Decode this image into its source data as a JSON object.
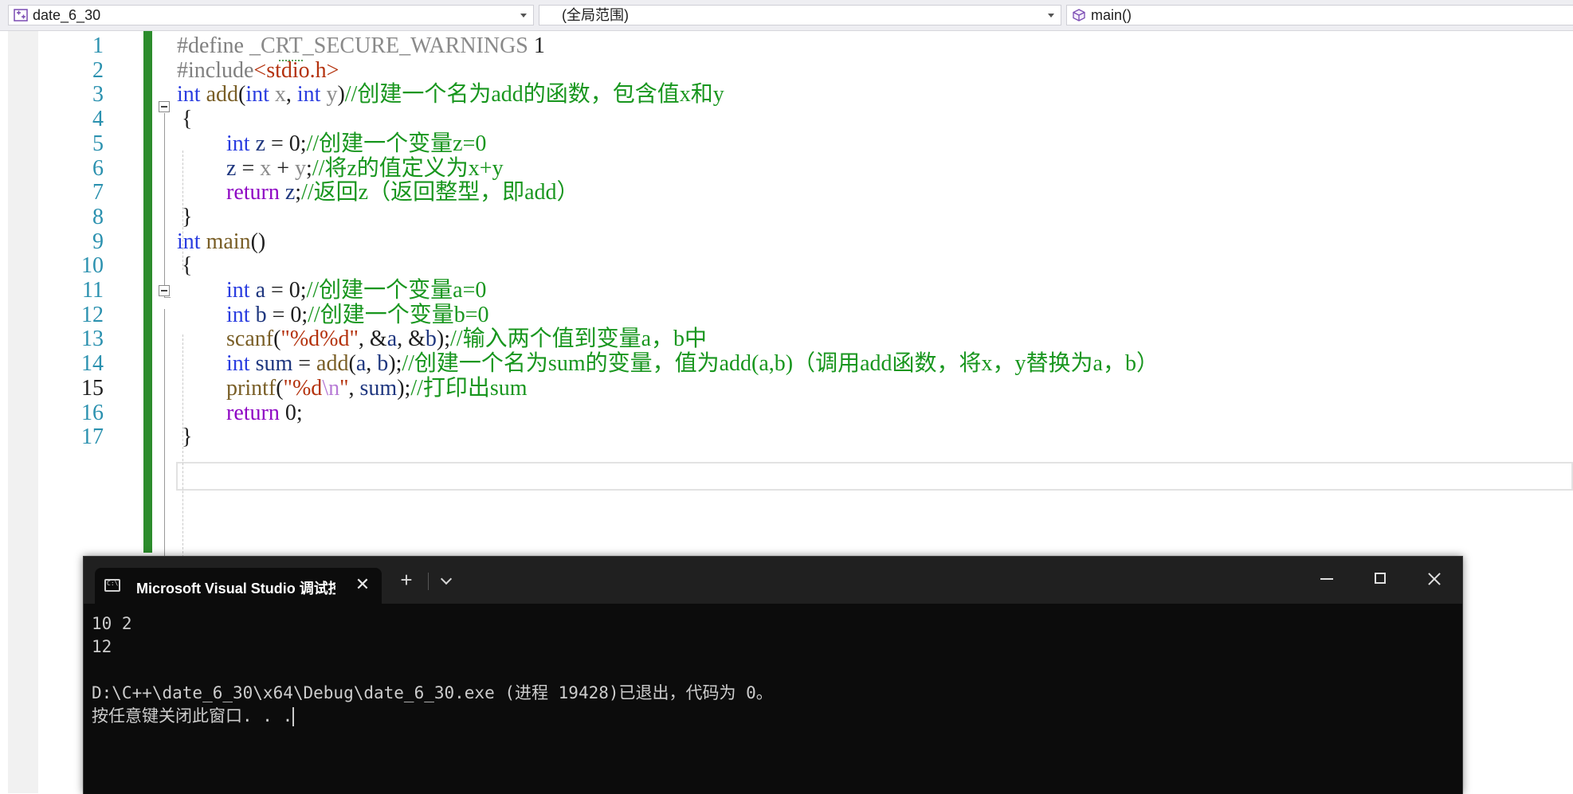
{
  "navbar": {
    "project": "date_6_30",
    "scope": "(全局范围)",
    "member": "main()"
  },
  "editor": {
    "line_numbers": [
      "1",
      "2",
      "3",
      "4",
      "5",
      "6",
      "7",
      "8",
      "9",
      "10",
      "11",
      "12",
      "13",
      "14",
      "15",
      "16",
      "17"
    ],
    "current_line": 15,
    "lines": [
      [
        [
          "#define ",
          "pp"
        ],
        [
          "_CRT_SECURE_WARNINGS",
          "pr"
        ],
        [
          " 1",
          "tx"
        ]
      ],
      [
        [
          "#include",
          "pp"
        ],
        [
          "<stdio.h>",
          "st"
        ]
      ],
      [
        [
          "int",
          "kw"
        ],
        [
          " ",
          "tx"
        ],
        [
          "add",
          "fn"
        ],
        [
          "(",
          "tx"
        ],
        [
          "int",
          "kw"
        ],
        [
          " ",
          "tx"
        ],
        [
          "x",
          "pr"
        ],
        [
          ", ",
          "tx"
        ],
        [
          "int",
          "kw"
        ],
        [
          " ",
          "tx"
        ],
        [
          "y",
          "pr"
        ],
        [
          ")",
          "tx"
        ],
        [
          "//创建一个名为add的函数，包含值x和y",
          "cm"
        ]
      ],
      [
        [
          "{",
          "tx"
        ]
      ],
      [
        [
          "int",
          "kw"
        ],
        [
          " ",
          "tx"
        ],
        [
          "z",
          "lv"
        ],
        [
          " = 0;",
          "tx"
        ],
        [
          "//创建一个变量z=0",
          "cm"
        ]
      ],
      [
        [
          "z",
          "lv"
        ],
        [
          " = ",
          "tx"
        ],
        [
          "x",
          "pr"
        ],
        [
          " + ",
          "tx"
        ],
        [
          "y",
          "pr"
        ],
        [
          ";",
          "tx"
        ],
        [
          "//将z的值定义为x+y",
          "cm"
        ]
      ],
      [
        [
          "return",
          "ret"
        ],
        [
          " ",
          "tx"
        ],
        [
          "z",
          "lv"
        ],
        [
          ";",
          "tx"
        ],
        [
          "//返回z（返回整型，即add）",
          "cm"
        ]
      ],
      [
        [
          "}",
          "tx"
        ]
      ],
      [
        [
          "int",
          "kw"
        ],
        [
          " ",
          "tx"
        ],
        [
          "main",
          "fn"
        ],
        [
          "()",
          "tx"
        ]
      ],
      [
        [
          "{",
          "tx"
        ]
      ],
      [
        [
          "int",
          "kw"
        ],
        [
          " ",
          "tx"
        ],
        [
          "a",
          "lv"
        ],
        [
          " = 0;",
          "tx"
        ],
        [
          "//创建一个变量a=0",
          "cm"
        ]
      ],
      [
        [
          "int",
          "kw"
        ],
        [
          " ",
          "tx"
        ],
        [
          "b",
          "lv"
        ],
        [
          " = 0;",
          "tx"
        ],
        [
          "//创建一个变量b=0",
          "cm"
        ]
      ],
      [
        [
          "scanf",
          "fn"
        ],
        [
          "(",
          "tx"
        ],
        [
          "\"%d%d\"",
          "st"
        ],
        [
          ", &",
          "tx"
        ],
        [
          "a",
          "lv"
        ],
        [
          ", &",
          "tx"
        ],
        [
          "b",
          "lv"
        ],
        [
          ");",
          "tx"
        ],
        [
          "//输入两个值到变量a，b中",
          "cm"
        ]
      ],
      [
        [
          "int",
          "kw"
        ],
        [
          " ",
          "tx"
        ],
        [
          "sum",
          "lv"
        ],
        [
          " = ",
          "tx"
        ],
        [
          "add",
          "fn"
        ],
        [
          "(",
          "tx"
        ],
        [
          "a",
          "lv"
        ],
        [
          ", ",
          "tx"
        ],
        [
          "b",
          "lv"
        ],
        [
          ");",
          "tx"
        ],
        [
          "//创建一个名为sum的变量，值为add(a,b)（调用add函数，将x，y替换为a，b）",
          "cm"
        ]
      ],
      [
        [
          "printf",
          "fn"
        ],
        [
          "(",
          "tx"
        ],
        [
          "\"%d",
          "st"
        ],
        [
          "\\n",
          "esc"
        ],
        [
          "\"",
          "st"
        ],
        [
          ", ",
          "tx"
        ],
        [
          "sum",
          "lv"
        ],
        [
          ");",
          "tx"
        ],
        [
          "//打印出sum",
          "cm"
        ]
      ],
      [
        [
          "return",
          "ret"
        ],
        [
          " 0;",
          "tx"
        ]
      ],
      [
        [
          "}",
          "tx"
        ]
      ]
    ]
  },
  "terminal": {
    "tab_title": "Microsoft Visual Studio 调试控制台",
    "tab_close": "✕",
    "new_tab": "+",
    "lines": [
      "10 2",
      "12",
      "",
      "D:\\C++\\date_6_30\\x64\\Debug\\date_6_30.exe (进程 19428)已退出，代码为 0。",
      "按任意键关闭此窗口. . ."
    ]
  },
  "colors": {
    "keyword": "#2a3de0",
    "return_keyword": "#8f08c4",
    "comment": "#18961e",
    "string": "#b4320d",
    "function": "#795e26",
    "line_number": "#2b91af",
    "change_bar": "#2c8c2c",
    "terminal_bg": "#0c0c0c",
    "terminal_titlebar": "#202020"
  },
  "icons": {
    "project": "project-icon",
    "member": "cube-icon",
    "terminal": "console-icon"
  }
}
